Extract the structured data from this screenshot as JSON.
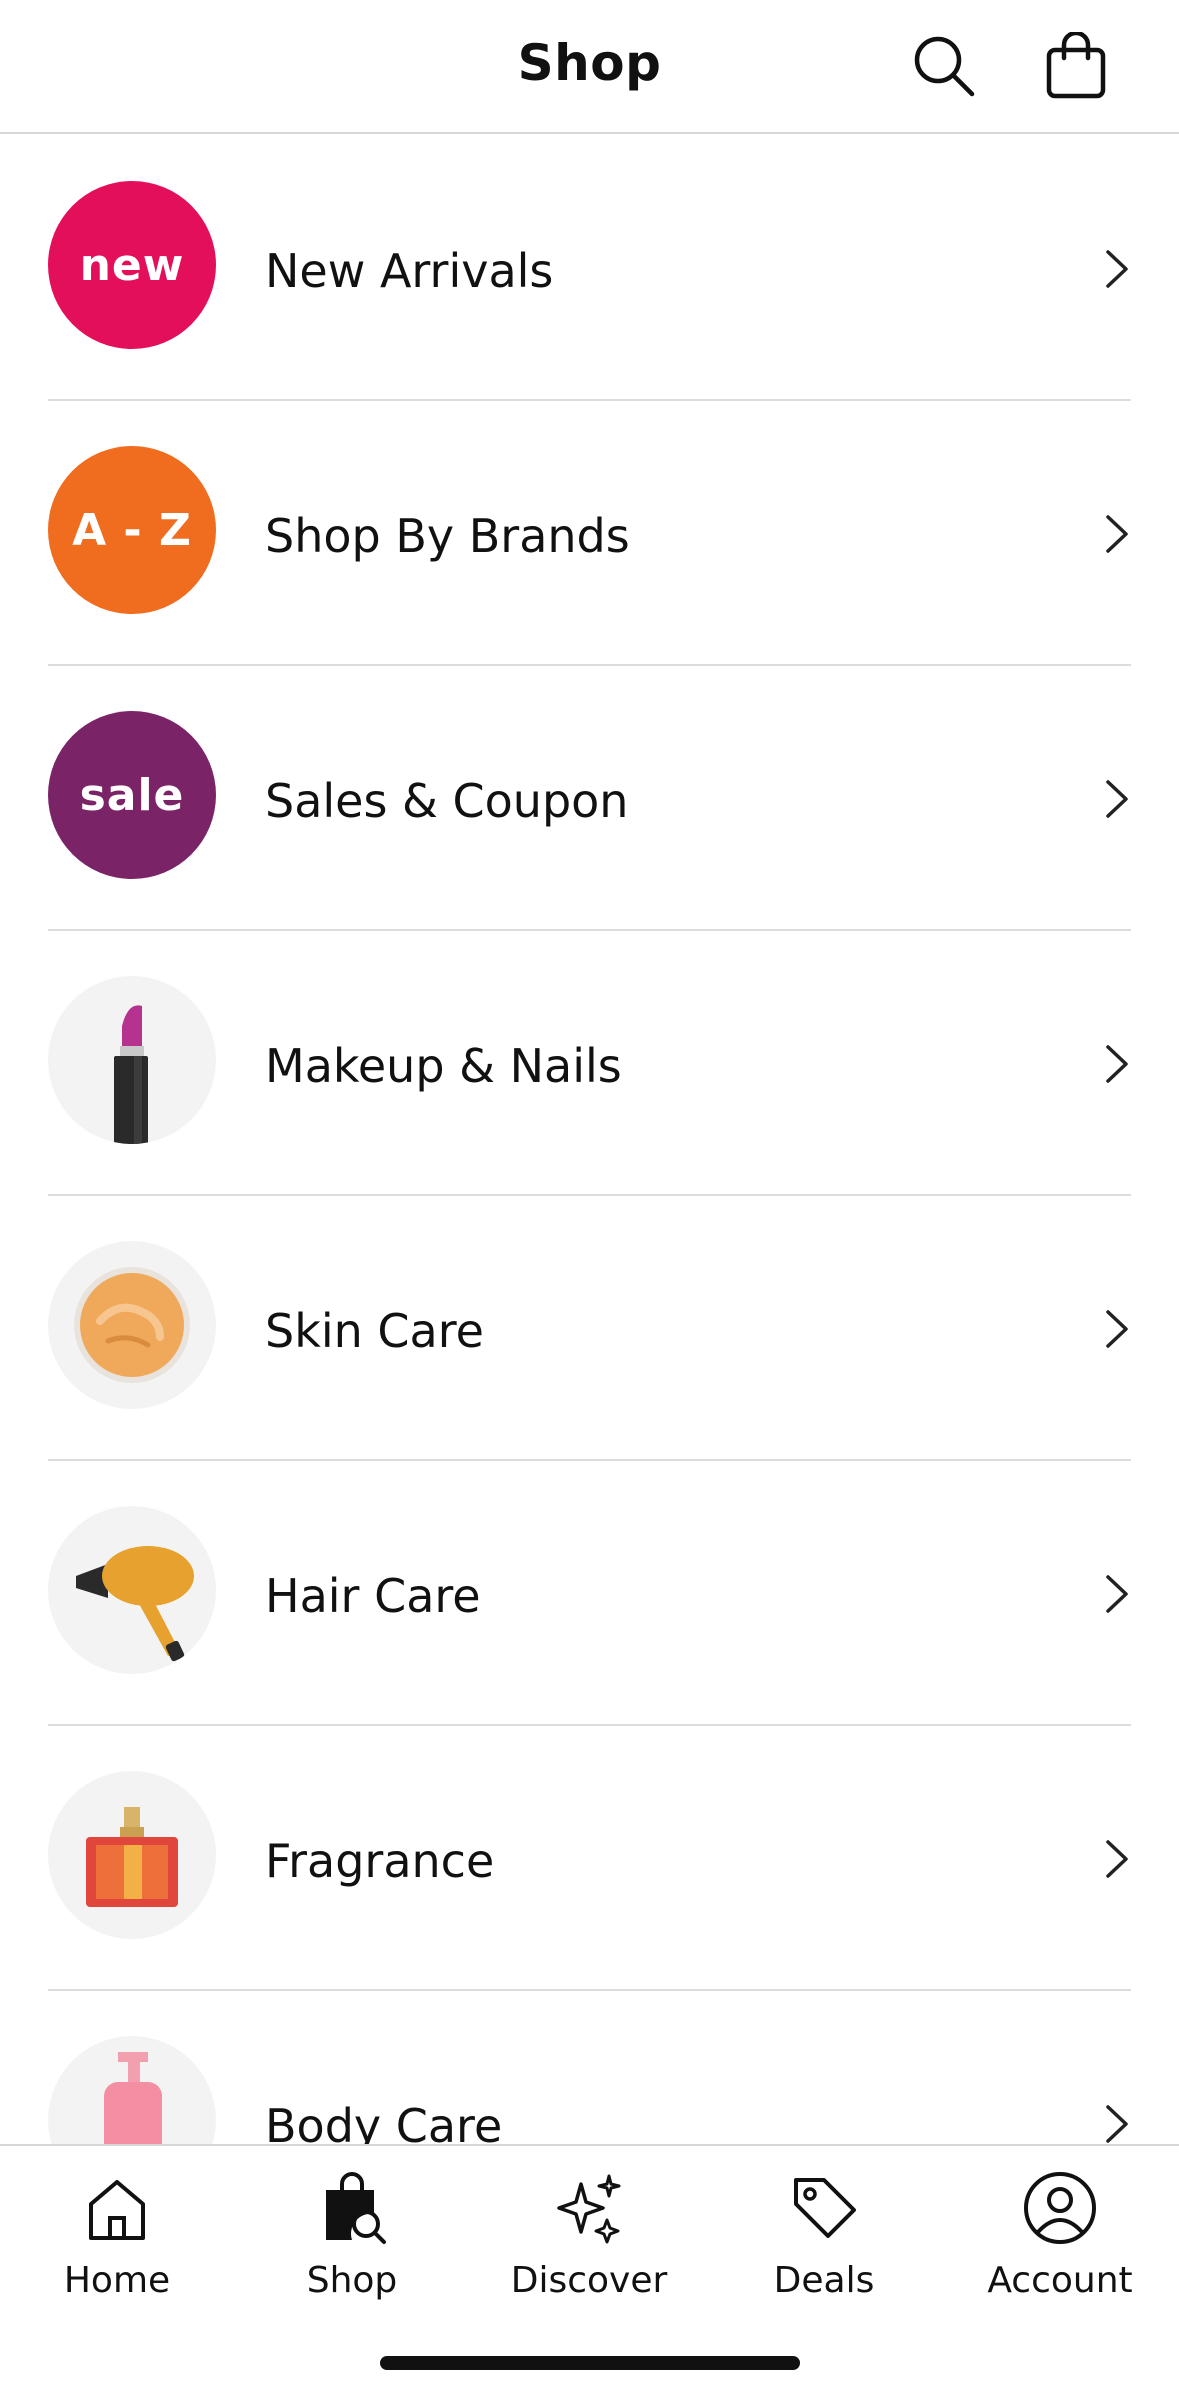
{
  "header": {
    "title": "Shop",
    "search_icon": "search-icon",
    "bag_icon": "shopping-bag-icon"
  },
  "categories": [
    {
      "label": "New Arrivals",
      "badge_text": "new",
      "badge_color": "#e40f5b"
    },
    {
      "label": "Shop By Brands",
      "badge_text": "A - Z",
      "badge_color": "#f06c1f"
    },
    {
      "label": "Sales & Coupon",
      "badge_text": "sale",
      "badge_color": "#7b2367"
    },
    {
      "label": "Makeup & Nails",
      "image": "lipstick"
    },
    {
      "label": "Skin Care",
      "image": "cream-jar"
    },
    {
      "label": "Hair Care",
      "image": "hair-dryer"
    },
    {
      "label": "Fragrance",
      "image": "perfume-bottle"
    },
    {
      "label": "Body Care",
      "image": "lotion-bottle"
    }
  ],
  "tabbar": {
    "tabs": [
      {
        "label": "Home",
        "icon": "home-icon"
      },
      {
        "label": "Shop",
        "icon": "shop-bag-search-icon",
        "active": true
      },
      {
        "label": "Discover",
        "icon": "sparkles-icon"
      },
      {
        "label": "Deals",
        "icon": "tag-icon"
      },
      {
        "label": "Account",
        "icon": "account-icon"
      }
    ]
  }
}
